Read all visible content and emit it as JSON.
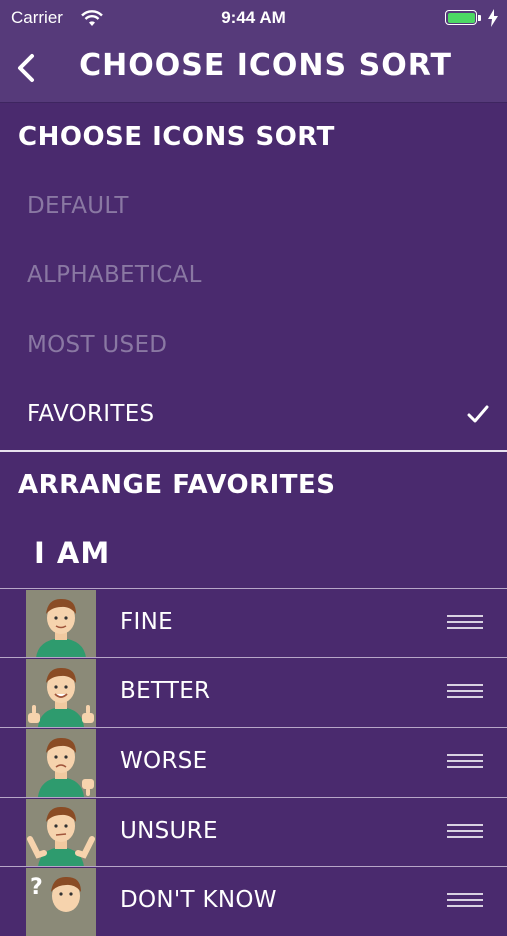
{
  "status_bar": {
    "carrier": "Carrier",
    "time": "9:44 AM",
    "battery_color": "#4cd964"
  },
  "nav": {
    "title": "CHOOSE ICONS SORT",
    "back_icon": "chevron-left-icon"
  },
  "sort_section": {
    "header": "CHOOSE ICONS SORT",
    "options": [
      {
        "label": "DEFAULT",
        "selected": false
      },
      {
        "label": "ALPHABETICAL",
        "selected": false
      },
      {
        "label": "MOST USED",
        "selected": false
      },
      {
        "label": "FAVORITES",
        "selected": true
      }
    ]
  },
  "favorites_section": {
    "header": "ARRANGE FAVORITES",
    "group_title": "I AM",
    "items": [
      {
        "label": "FINE",
        "icon": "boy-fine-icon"
      },
      {
        "label": "BETTER",
        "icon": "boy-thumbs-up-icon"
      },
      {
        "label": "WORSE",
        "icon": "boy-thumbs-down-icon"
      },
      {
        "label": "UNSURE",
        "icon": "boy-shrug-icon"
      },
      {
        "label": "DON'T KNOW",
        "icon": "boy-question-icon"
      }
    ]
  },
  "colors": {
    "background": "#4a2a6e",
    "nav_background": "#563a7a",
    "dim_text": "#8a78a3"
  }
}
